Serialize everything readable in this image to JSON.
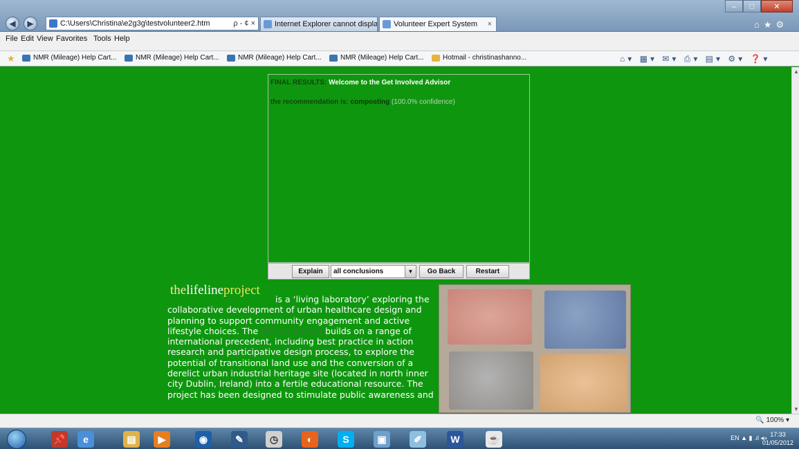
{
  "browser": {
    "address": "C:\\Users\\Christina\\e2g3g\\testvolunteer2.htm",
    "address_tools": "ρ - ¢ ×",
    "tabs": [
      {
        "label": "Internet Explorer cannot displa..."
      },
      {
        "label": "Volunteer Expert System"
      }
    ],
    "tab_close": "×",
    "menu": [
      "File",
      "Edit",
      "View",
      "Favorites",
      "Tools",
      "Help"
    ],
    "favorites": [
      "NMR (Mileage) Help Cart...",
      "NMR (Mileage) Help Cart...",
      "NMR (Mileage) Help Cart...",
      "NMR (Mileage) Help Cart...",
      "Hotmail - christinashanno..."
    ],
    "zoom": "100%"
  },
  "applet": {
    "label_final": "FINAL RESULTS:",
    "welcome": "Welcome to the Get Involved Advisor",
    "recommendation_prefix": "the recommendation is:",
    "recommendation": "composting",
    "confidence": "(100.0% confidence)",
    "controls": {
      "explain": "Explain",
      "conclusions_select": "all conclusions",
      "go_back": "Go Back",
      "restart": "Restart"
    }
  },
  "content": {
    "brand_the": "the",
    "brand_lifeline": "lifeline",
    "brand_project": "project",
    "desc_part1": "is a ‘living laboratory’ exploring the collaborative development of urban healthcare design and planning to support community engagement and active lifestyle choices. The ",
    "desc_link": "lifeline project",
    "desc_part2": " builds on a range of international precedent, including best practice in action research and participative design process, to explore the potential of transitional land use and the conversion of a derelict urban industrial heritage site (located in north inner city Dublin, Ireland) into a fertile educational resource. The project has been designed to stimulate public awareness and"
  },
  "taskbar": {
    "tray_lang": "EN",
    "time": "17:33",
    "date": "01/05/2012"
  }
}
